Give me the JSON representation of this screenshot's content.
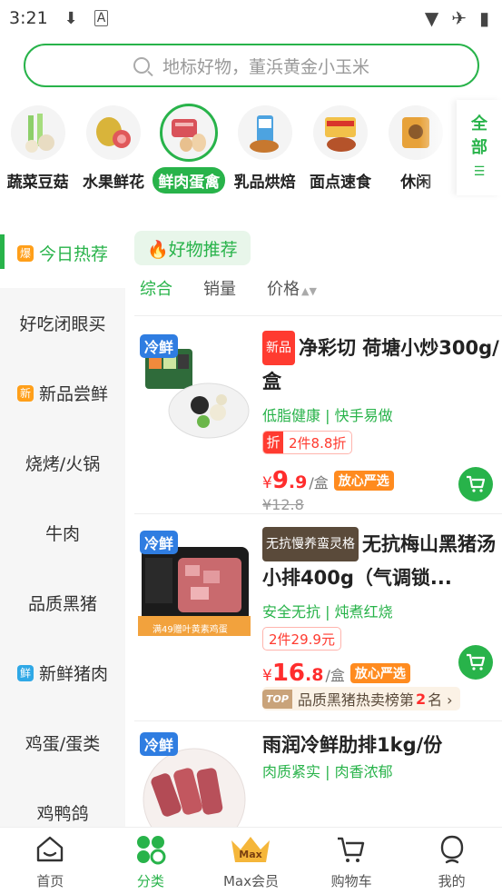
{
  "status_bar": {
    "time": "3:21",
    "left_icons": [
      "download-icon",
      "font-icon"
    ],
    "right_icons": [
      "wifi-icon",
      "airplane-icon",
      "battery-icon"
    ]
  },
  "search": {
    "placeholder": "地标好物，董浜黄金小玉米"
  },
  "categories": [
    {
      "label": "蔬菜豆菇",
      "icon": "vegetables-icon",
      "active": false
    },
    {
      "label": "水果鲜花",
      "icon": "fruit-icon",
      "active": false
    },
    {
      "label": "鲜肉蛋禽",
      "icon": "meat-icon",
      "active": true
    },
    {
      "label": "乳品烘焙",
      "icon": "dairy-icon",
      "active": false
    },
    {
      "label": "面点速食",
      "icon": "noodle-icon",
      "active": false
    },
    {
      "label": "休闲",
      "icon": "snack-icon",
      "active": false
    }
  ],
  "all_categories": [
    "全",
    "部",
    "☰"
  ],
  "sidebar": {
    "items": [
      {
        "label": "今日热荐",
        "badge": "爆",
        "badge_color": "#ff9f1a",
        "active": true
      },
      {
        "label": "好吃闭眼买",
        "badge": "",
        "active": false
      },
      {
        "label": "新品尝鲜",
        "badge": "新",
        "badge_color": "#ff9f1a",
        "active": false
      },
      {
        "label": "烧烤/火锅",
        "badge": "",
        "active": false
      },
      {
        "label": "牛肉",
        "badge": "",
        "active": false
      },
      {
        "label": "品质黑猪",
        "badge": "",
        "active": false
      },
      {
        "label": "新鲜猪肉",
        "badge": "鲜",
        "badge_color": "#2fa8e6",
        "active": false
      },
      {
        "label": "鸡蛋/蛋类",
        "badge": "",
        "active": false
      },
      {
        "label": "鸡鸭鸽",
        "badge": "",
        "active": false
      }
    ]
  },
  "content": {
    "section_tag": "🔥好物推荐",
    "sorts": [
      {
        "label": "综合",
        "active": true
      },
      {
        "label": "销量",
        "active": false
      },
      {
        "label": "价格",
        "active": false
      }
    ],
    "products": [
      {
        "badge": "冷鲜",
        "pill": "新品",
        "title": "净彩切 荷塘小炒300g/盒",
        "sub": "低脂健康 | 快手易做",
        "promo_tag": "折",
        "promo_text": "2件8.8折",
        "price_currency": "¥",
        "price_int": "9",
        "price_dec": ".9",
        "price_unit": "/盒",
        "trust": "放心严选",
        "old_price": "¥12.8"
      },
      {
        "badge": "冷鲜",
        "pill": "无抗慢养蛮灵格",
        "title": "无抗梅山黑猪汤小排400g（气调锁...",
        "sub": "安全无抗 | 炖煮红烧",
        "promo_text": "2件29.9元",
        "price_currency": "¥",
        "price_int": "16",
        "price_dec": ".8",
        "price_unit": "/盒",
        "trust": "放心严选",
        "img_banner": "满49赠叶黄素鸡蛋",
        "rank_tag": "TOP",
        "rank_text_pre": "品质黑猪热卖榜第",
        "rank_num": "2",
        "rank_text_post": "名 ›"
      },
      {
        "badge": "冷鲜",
        "title": "雨润冷鲜肋排1kg/份",
        "sub": "肉质紧实 | 肉香浓郁"
      }
    ]
  },
  "bottom_nav": [
    {
      "label": "首页",
      "icon": "home-icon",
      "active": false
    },
    {
      "label": "分类",
      "icon": "category-icon",
      "active": true
    },
    {
      "label": "Max会员",
      "icon": "crown-icon",
      "icon_text": "Max",
      "active": false
    },
    {
      "label": "购物车",
      "icon": "cart-icon",
      "active": false
    },
    {
      "label": "我的",
      "icon": "profile-icon",
      "active": false
    }
  ],
  "colors": {
    "accent": "#28b34a",
    "price": "#ff2d2d",
    "cold_badge": "#2f7de1",
    "trust": "#ff8b1f"
  }
}
